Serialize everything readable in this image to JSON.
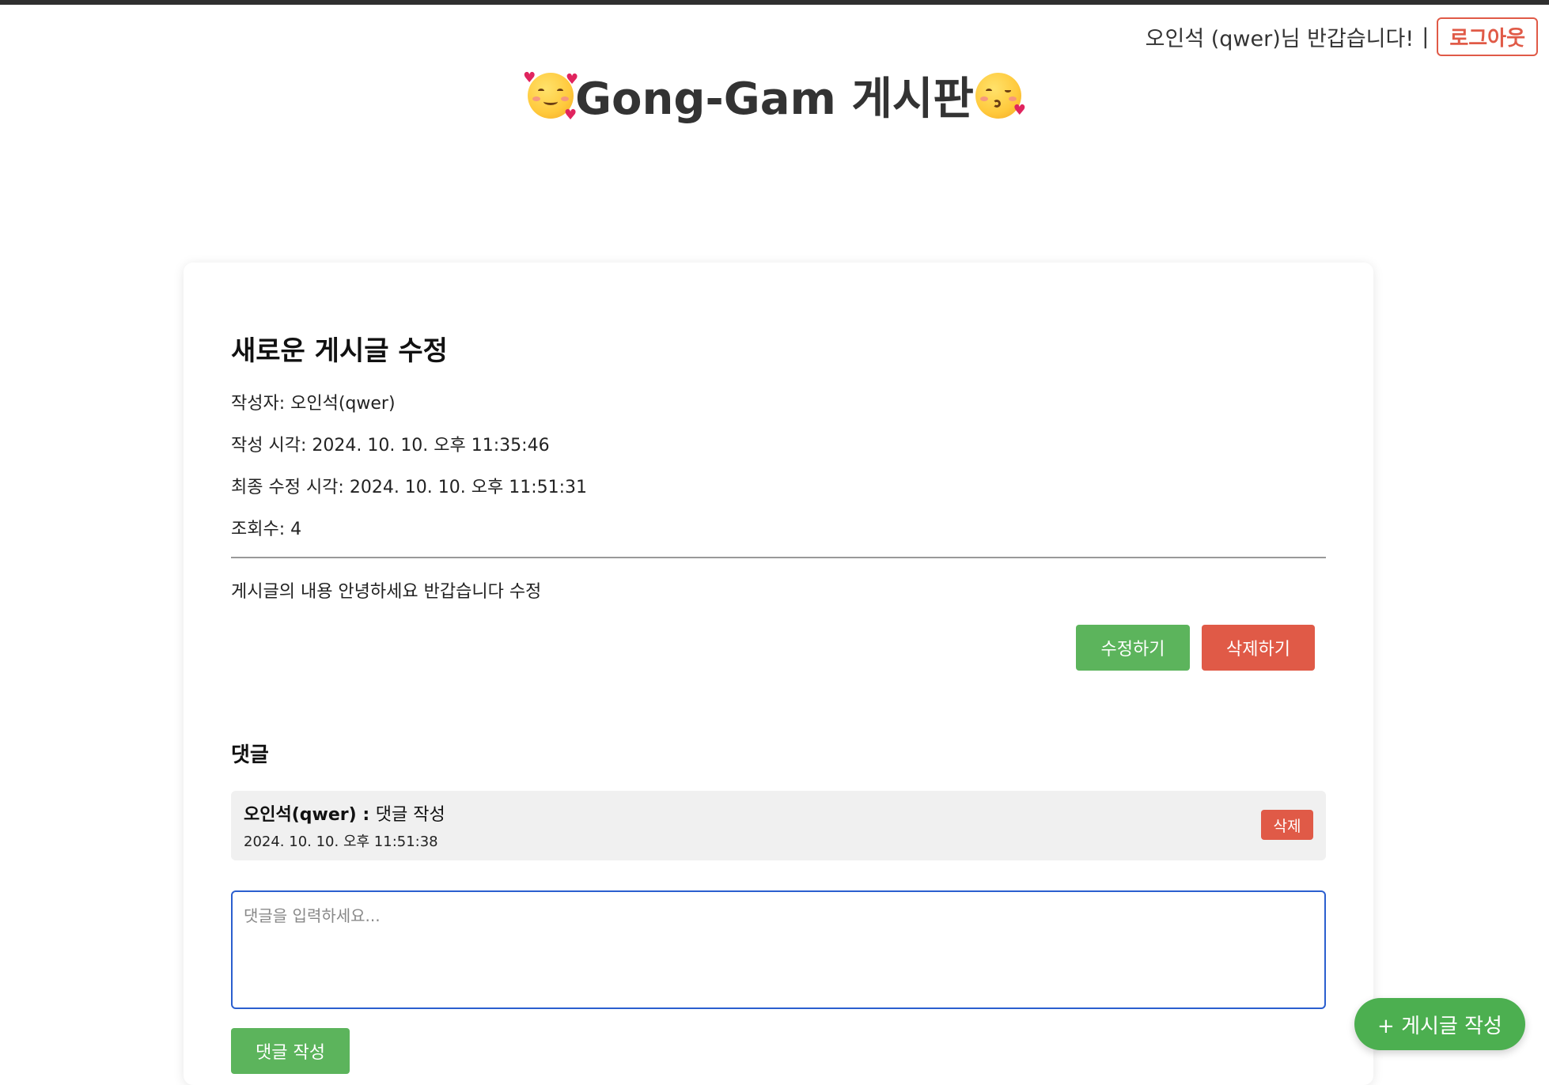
{
  "header": {
    "greeting": "오인석 (qwer)님 반갑습니다!",
    "separator": "|",
    "logout_label": "로그아웃",
    "site_title": "Gong-Gam 게시판"
  },
  "post": {
    "title": "새로운 게시글 수정",
    "author": "작성자: 오인석(qwer)",
    "created_at": "작성 시각: 2024. 10. 10. 오후 11:35:46",
    "updated_at": "최종 수정 시각: 2024. 10. 10. 오후 11:51:31",
    "views": "조회수: 4",
    "content": "게시글의 내용 안녕하세요 반갑습니다 수정",
    "edit_label": "수정하기",
    "delete_label": "삭제하기"
  },
  "comments": {
    "title": "댓글",
    "items": [
      {
        "author": "오인석(qwer) : ",
        "text": "댓글 작성",
        "time": "2024. 10. 10. 오후 11:51:38",
        "delete_label": "삭제"
      }
    ],
    "input_placeholder": "댓글을 입력하세요...",
    "submit_label": "댓글 작성"
  },
  "fab": {
    "label": "+ 게시글 작성"
  },
  "colors": {
    "accent_green": "#5cb45c",
    "danger_red": "#e05a47",
    "focus_blue": "#2b5fcf"
  }
}
